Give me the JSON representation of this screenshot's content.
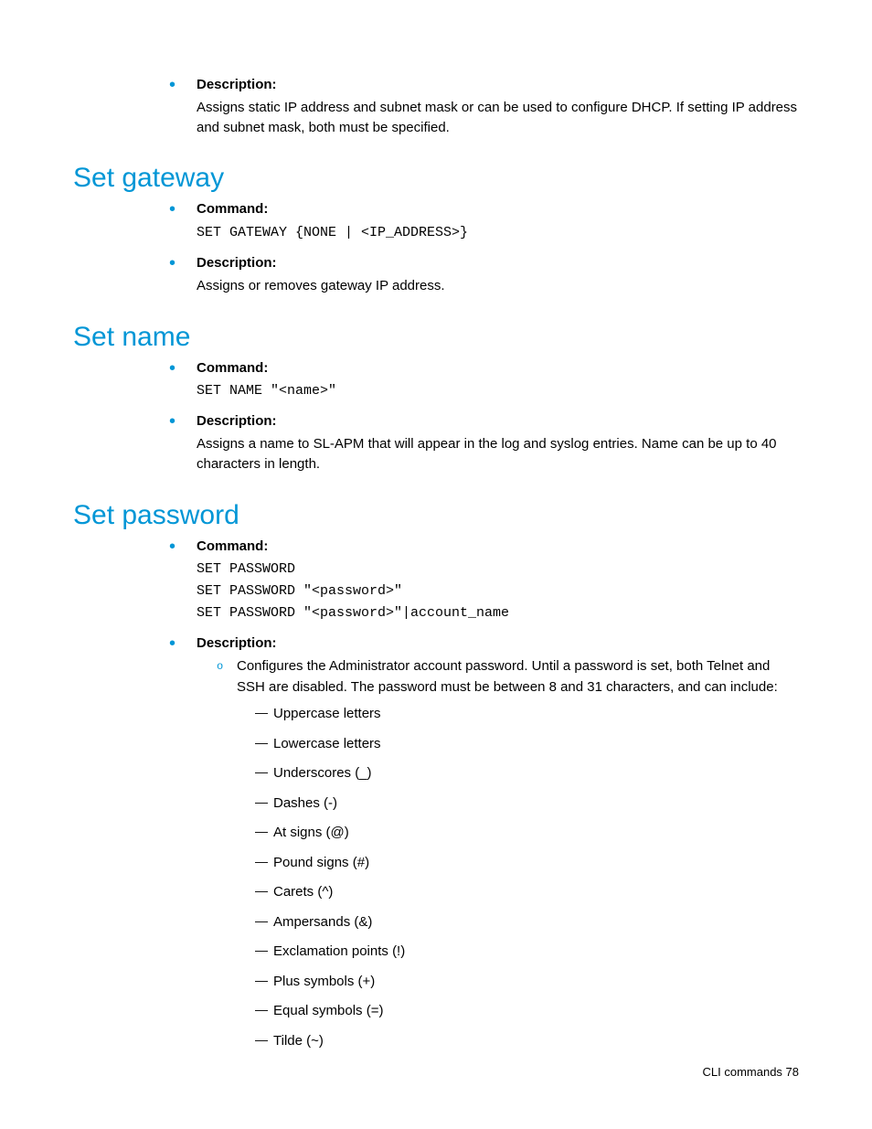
{
  "top": {
    "desc_label": "Description:",
    "desc_text": "Assigns static IP address and subnet mask or can be used to configure DHCP. If setting IP address and subnet mask, both must be specified."
  },
  "gateway": {
    "heading": "Set gateway",
    "cmd_label": "Command:",
    "cmd_text": "SET GATEWAY {NONE | <IP_ADDRESS>}",
    "desc_label": "Description:",
    "desc_text": "Assigns or removes gateway IP address."
  },
  "name": {
    "heading": "Set name",
    "cmd_label": "Command:",
    "cmd_text": "SET NAME \"<name>\"",
    "desc_label": "Description:",
    "desc_text": "Assigns a name to SL-APM that will appear in the log and syslog entries. Name can be up to 40 characters in length."
  },
  "password": {
    "heading": "Set password",
    "cmd_label": "Command:",
    "cmd_text": "SET PASSWORD\nSET PASSWORD \"<password>\"\nSET PASSWORD \"<password>\"|account_name",
    "desc_label": "Description:",
    "desc_sub": "Configures the Administrator account password. Until a password is set, both Telnet and SSH are disabled. The password must be between 8 and 31 characters, and can include:",
    "items": {
      "0": "Uppercase letters",
      "1": "Lowercase letters",
      "2": "Underscores (_)",
      "3": "Dashes (-)",
      "4": "At signs (@)",
      "5": "Pound signs (#)",
      "6": "Carets (^)",
      "7": "Ampersands (&)",
      "8": "Exclamation points (!)",
      "9": "Plus symbols (+)",
      "10": "Equal symbols (=)",
      "11": "Tilde (~)"
    }
  },
  "footer": {
    "text": "CLI commands   78"
  }
}
